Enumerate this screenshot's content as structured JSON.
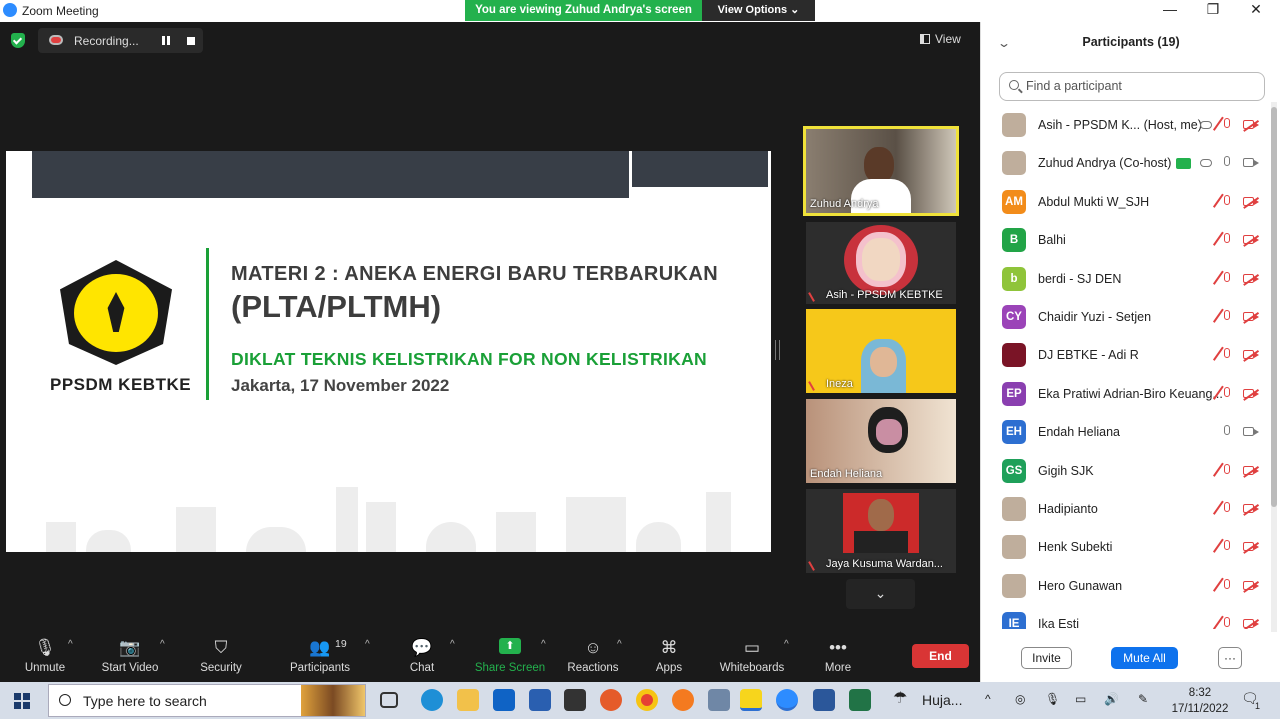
{
  "window": {
    "title": "Zoom Meeting",
    "viewing_banner": "You are viewing Zuhud Andrya's screen",
    "view_options": "View Options ⌄",
    "minimize": "—",
    "restore": "❐",
    "close": "✕"
  },
  "meeting": {
    "recording_label": "Recording...",
    "view_label": "View"
  },
  "slide": {
    "logo_caption": "PPSDM KEBTKE",
    "title_line1": "MATERI 2 : ANEKA ENERGI BARU TERBARUKAN",
    "title_line2": "(PLTA/PLTMH)",
    "subtitle": "DIKLAT TEKNIS KELISTRIKAN FOR NON KELISTRIKAN",
    "date": "Jakarta, 17 November 2022"
  },
  "video_tiles": [
    {
      "name": "Zuhud Andrya",
      "color": "#6e6458",
      "muted": false
    },
    {
      "name": "Asih - PPSDM KEBTKE",
      "color": "#c8323c",
      "muted": true
    },
    {
      "name": "Ineza",
      "color": "#f6c81a",
      "muted": true
    },
    {
      "name": "Endah Heliana",
      "color": "#b9927a",
      "muted": false
    },
    {
      "name": "Jaya Kusuma Wardan...",
      "color": "#cc2a2a",
      "muted": true
    }
  ],
  "toolbar": {
    "unmute": "Unmute",
    "start_video": "Start Video",
    "security": "Security",
    "participants": "Participants",
    "participants_count": "19",
    "chat": "Chat",
    "share_screen": "Share Screen",
    "reactions": "Reactions",
    "apps": "Apps",
    "whiteboards": "Whiteboards",
    "more": "More",
    "end": "End"
  },
  "panel": {
    "title": "Participants (19)",
    "search_placeholder": "Find a participant",
    "invite": "Invite",
    "mute_all": "Mute All",
    "more": "···",
    "participants": [
      {
        "initials": "",
        "name": "Asih - PPSDM K...  (Host, me)",
        "color": "photo",
        "mic": "off",
        "cam": "off"
      },
      {
        "initials": "",
        "name": "Zuhud Andrya (Co-host)",
        "color": "photo",
        "mic": "on",
        "cam": "on"
      },
      {
        "initials": "AM",
        "name": "Abdul Mukti W_SJH",
        "color": "#f28c1a",
        "mic": "off",
        "cam": "off"
      },
      {
        "initials": "B",
        "name": "Balhi",
        "color": "#22a447",
        "mic": "off",
        "cam": "off"
      },
      {
        "initials": "b",
        "name": "berdi - SJ DEN",
        "color": "#8fc43a",
        "mic": "off",
        "cam": "off"
      },
      {
        "initials": "CY",
        "name": "Chaidir Yuzi - Setjen",
        "color": "#9b44b8",
        "mic": "off",
        "cam": "off"
      },
      {
        "initials": "",
        "name": "DJ EBTKE - Adi R",
        "color": "#7a1426",
        "mic": "off",
        "cam": "off"
      },
      {
        "initials": "EP",
        "name": "Eka Pratiwi Adrian-Biro Keuang...",
        "color": "#8a3fb0",
        "mic": "off",
        "cam": "off"
      },
      {
        "initials": "EH",
        "name": "Endah Heliana",
        "color": "#2d6fd1",
        "mic": "on",
        "cam": "on"
      },
      {
        "initials": "GS",
        "name": "Gigih SJK",
        "color": "#1fa05a",
        "mic": "off",
        "cam": "off"
      },
      {
        "initials": "",
        "name": "Hadipianto",
        "color": "photo",
        "mic": "off",
        "cam": "off"
      },
      {
        "initials": "",
        "name": "Henk Subekti",
        "color": "photo",
        "mic": "off",
        "cam": "off"
      },
      {
        "initials": "",
        "name": "Hero Gunawan",
        "color": "photo",
        "mic": "off",
        "cam": "off"
      },
      {
        "initials": "IE",
        "name": "Ika Esti",
        "color": "#2d6fd1",
        "mic": "off",
        "cam": "off"
      }
    ]
  },
  "taskbar": {
    "search_placeholder": "Type here to search",
    "weather": "Huja...",
    "time": "8:32",
    "date": "17/11/2022",
    "notification_count": "1"
  }
}
